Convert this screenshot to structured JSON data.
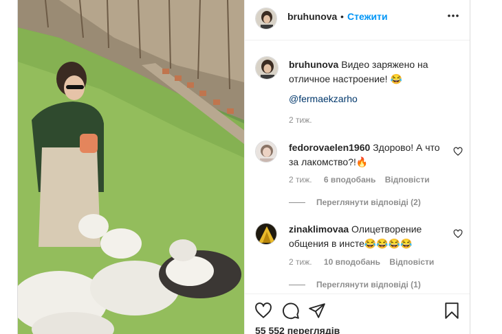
{
  "post": {
    "username": "bruhunova",
    "separator": "•",
    "follow_label": "Стежити",
    "more_icon": "more-horizontal-icon"
  },
  "caption": {
    "username": "bruhunova",
    "text": "Видео заряжено на отличное настроение! 😂",
    "mention": "@fermaekzarho",
    "time": "2 тиж."
  },
  "comments": [
    {
      "username": "fedorovaelen1960",
      "text": "Здорово! А что за лакомство?!🔥",
      "time": "2 тиж.",
      "likes": "6 вподобань",
      "reply_label": "Відповісти",
      "view_replies": "Переглянути відповіді (2)"
    },
    {
      "username": "zinaklimovaa",
      "text": "Олицетворение общения в инсте😂😂😂😂",
      "time": "2 тиж.",
      "likes": "10 вподобань",
      "reply_label": "Відповісти",
      "view_replies": "Переглянути відповіді (1)"
    }
  ],
  "actions": {
    "views": "55 552 переглядів",
    "icons": [
      "heart-icon",
      "comment-icon",
      "share-icon",
      "bookmark-icon"
    ]
  },
  "colors": {
    "link_blue": "#0095f6",
    "mention_blue": "#00376b",
    "muted": "#8e8e8e",
    "text": "#262626"
  }
}
